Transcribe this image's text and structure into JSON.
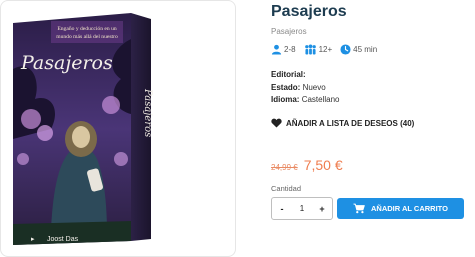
{
  "product": {
    "title": "Pasajeros",
    "subtitle": "Pasajeros",
    "box_art": {
      "tagline": "Engaño y deducción en un mundo más allá del nuestro",
      "logo_text": "Pasajeros",
      "spine_text": "Pasajeros",
      "author": "Joost Das"
    },
    "stats": {
      "players": "2-8",
      "age": "12+",
      "time": "45 min"
    },
    "specs": {
      "editorial_label": "Editorial:",
      "estado_label": "Estado:",
      "estado_value": "Nuevo",
      "idioma_label": "Idioma:",
      "idioma_value": "Castellano"
    },
    "wishlist_label": "AÑADIR A LISTA DE DESEOS (40)",
    "price": {
      "old": "24,99 €",
      "new": "7,50 €"
    },
    "quantity": {
      "label": "Cantidad",
      "minus": "-",
      "value": "1",
      "plus": "+"
    },
    "add_to_cart_label": "AÑADIR AL CARRITO"
  },
  "colors": {
    "title": "#1d3c50",
    "accent_blue": "#1e90e3",
    "price_orange": "#ef7d4f",
    "box_purple": "#3b2a5c"
  }
}
